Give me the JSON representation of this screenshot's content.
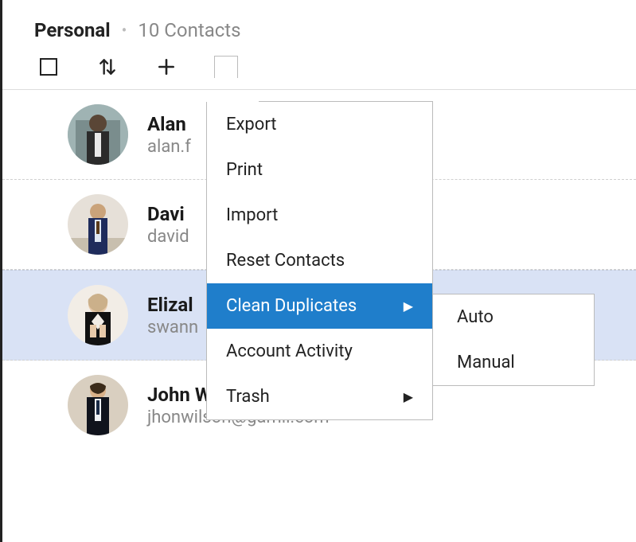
{
  "header": {
    "title": "Personal",
    "count_label": "10 Contacts"
  },
  "menu": {
    "export": "Export",
    "print": "Print",
    "import": "Import",
    "reset": "Reset Contacts",
    "clean_duplicates": "Clean Duplicates",
    "account_activity": "Account Activity",
    "trash": "Trash"
  },
  "submenu": {
    "auto": "Auto",
    "manual": "Manual"
  },
  "contacts": [
    {
      "name": "Alan",
      "email": "alan.f"
    },
    {
      "name": "Davi",
      "email": "david"
    },
    {
      "name": "Elizal",
      "email": "swann"
    },
    {
      "name": "John Wilson",
      "email": "jhonwilson@gamil.com"
    }
  ]
}
